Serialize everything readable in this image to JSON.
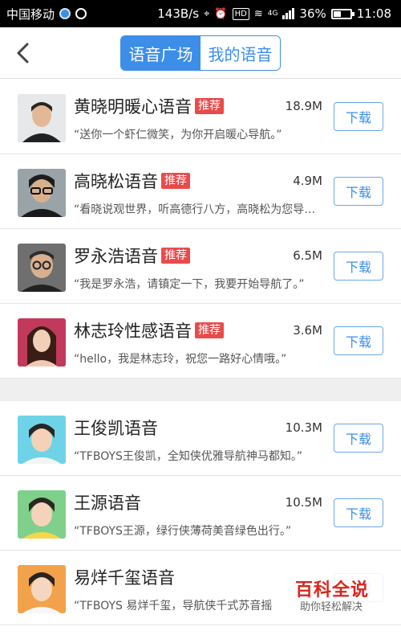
{
  "status_bar": {
    "carrier": "中国移动",
    "speed": "143B/s",
    "network": "4G",
    "battery": "36%",
    "time": "11:08",
    "hd_label": "HD"
  },
  "header": {
    "back_icon": "chevron-left-icon",
    "tabs": [
      {
        "label": "语音广场",
        "active": true
      },
      {
        "label": "我的语音",
        "active": false
      }
    ]
  },
  "voice_groups": [
    {
      "items": [
        {
          "name": "黄晓明暖心语音",
          "badge": "推荐",
          "size": "18.9M",
          "desc": "“送你一个虾仁微笑，为你开启暖心导航。”",
          "button": "下载"
        },
        {
          "name": "高晓松语音",
          "badge": "推荐",
          "size": "4.9M",
          "desc": "“看晓说观世界，听高德行八方，高晓松为您导…",
          "button": "下载"
        },
        {
          "name": "罗永浩语音",
          "badge": "推荐",
          "size": "6.5M",
          "desc": "“我是罗永浩，请镇定一下，我要开始导航了。”",
          "button": "下载"
        },
        {
          "name": "林志玲性感语音",
          "badge": "推荐",
          "size": "3.6M",
          "desc": "“hello，我是林志玲，祝您一路好心情哦。”",
          "button": "下载"
        }
      ]
    },
    {
      "items": [
        {
          "name": "王俊凯语音",
          "badge": "",
          "size": "10.3M",
          "desc": "“TFBOYS王俊凯，全知侠优雅导航神马都知。”",
          "button": "下载"
        },
        {
          "name": "王源语音",
          "badge": "",
          "size": "10.5M",
          "desc": "“TFBOYS王源，绿行侠薄荷美音绿色出行。”",
          "button": "下载"
        },
        {
          "name": "易烊千玺语音",
          "badge": "",
          "size": "",
          "desc": "“TFBOYS 易烊千玺，导航侠千式苏音摇",
          "button": "下载"
        }
      ]
    }
  ],
  "watermark": {
    "title": "百科全说",
    "subtitle": "助你轻松解决"
  }
}
